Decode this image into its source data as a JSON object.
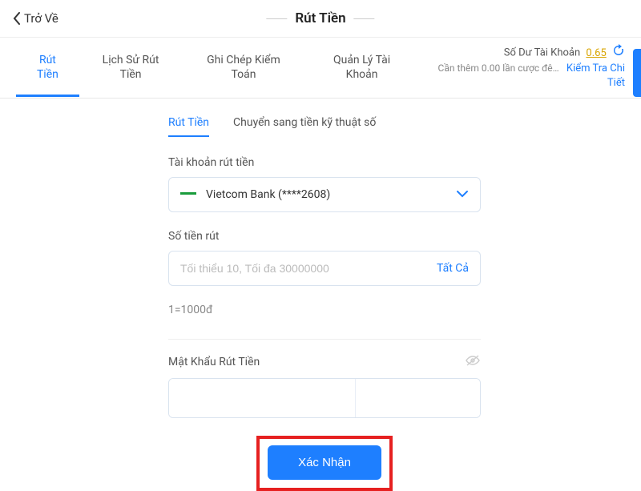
{
  "header": {
    "back_label": "Trở Về",
    "title": "Rút Tiền"
  },
  "main_tabs": [
    {
      "label": "Rút Tiền",
      "active": true
    },
    {
      "label": "Lịch Sử Rút Tiền",
      "active": false
    },
    {
      "label": "Ghi Chép Kiểm Toán",
      "active": false
    },
    {
      "label": "Quản Lý Tài Khoản",
      "active": false
    }
  ],
  "balance": {
    "label": "Số Dư Tài Khoản",
    "value": "0.65",
    "note": "Cần thêm 0.00 lần cược đê…",
    "detail_link": "Kiểm Tra Chi Tiết"
  },
  "sub_tabs": [
    {
      "label": "Rút Tiền",
      "active": true
    },
    {
      "label": "Chuyển sang tiền kỹ thuật số",
      "active": false
    }
  ],
  "form": {
    "account_label": "Tài khoản rút tiền",
    "account_value": "Vietcom Bank (****2608)",
    "amount_label": "Số tiền rút",
    "amount_placeholder": "Tối thiểu 10, Tối đa 30000000",
    "all_button": "Tất Cả",
    "rate_note": "1=1000đ",
    "password_label": "Mật Khẩu Rút Tiền",
    "submit_label": "Xác Nhận"
  }
}
